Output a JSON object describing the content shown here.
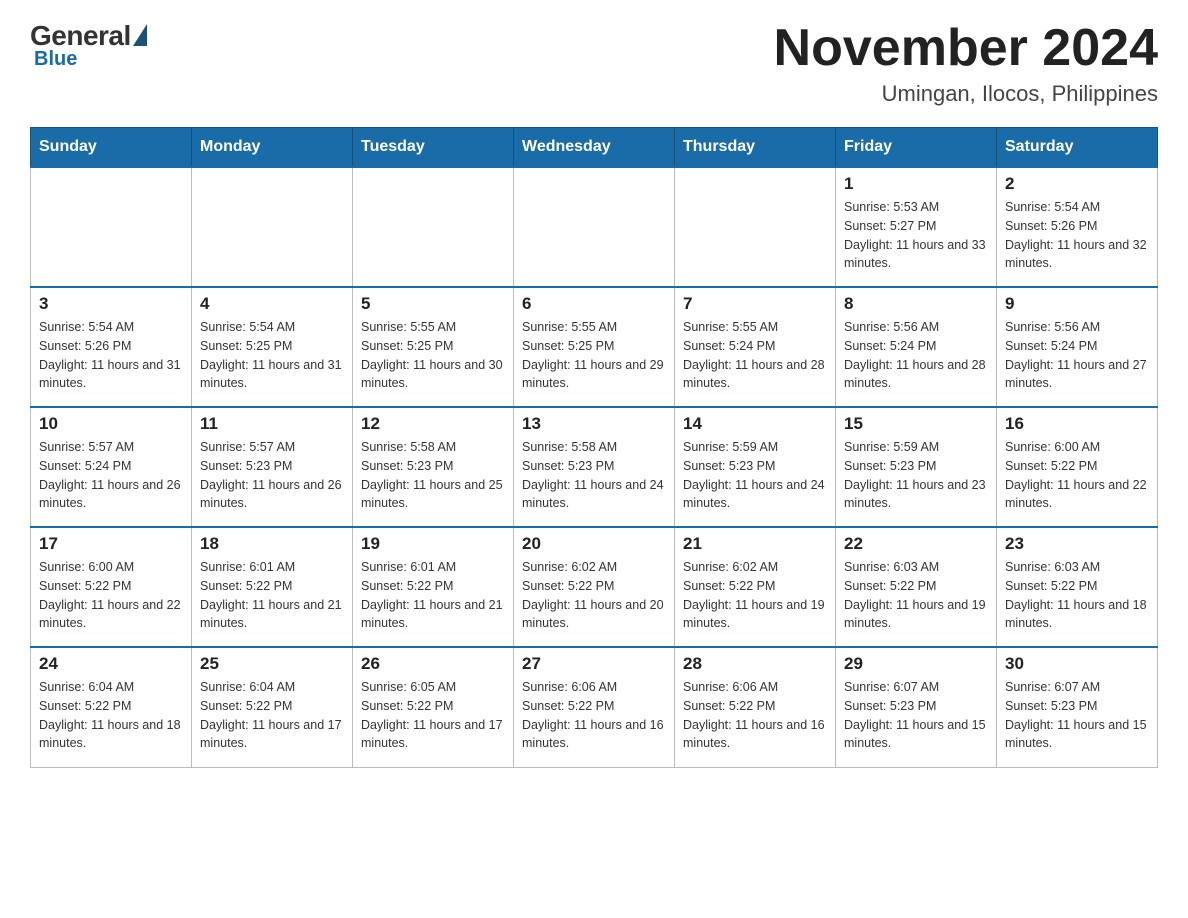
{
  "header": {
    "logo_general": "General",
    "logo_blue": "Blue",
    "month_title": "November 2024",
    "location": "Umingan, Ilocos, Philippines"
  },
  "weekdays": [
    "Sunday",
    "Monday",
    "Tuesday",
    "Wednesday",
    "Thursday",
    "Friday",
    "Saturday"
  ],
  "weeks": [
    [
      {
        "day": "",
        "sunrise": "",
        "sunset": "",
        "daylight": ""
      },
      {
        "day": "",
        "sunrise": "",
        "sunset": "",
        "daylight": ""
      },
      {
        "day": "",
        "sunrise": "",
        "sunset": "",
        "daylight": ""
      },
      {
        "day": "",
        "sunrise": "",
        "sunset": "",
        "daylight": ""
      },
      {
        "day": "",
        "sunrise": "",
        "sunset": "",
        "daylight": ""
      },
      {
        "day": "1",
        "sunrise": "Sunrise: 5:53 AM",
        "sunset": "Sunset: 5:27 PM",
        "daylight": "Daylight: 11 hours and 33 minutes."
      },
      {
        "day": "2",
        "sunrise": "Sunrise: 5:54 AM",
        "sunset": "Sunset: 5:26 PM",
        "daylight": "Daylight: 11 hours and 32 minutes."
      }
    ],
    [
      {
        "day": "3",
        "sunrise": "Sunrise: 5:54 AM",
        "sunset": "Sunset: 5:26 PM",
        "daylight": "Daylight: 11 hours and 31 minutes."
      },
      {
        "day": "4",
        "sunrise": "Sunrise: 5:54 AM",
        "sunset": "Sunset: 5:25 PM",
        "daylight": "Daylight: 11 hours and 31 minutes."
      },
      {
        "day": "5",
        "sunrise": "Sunrise: 5:55 AM",
        "sunset": "Sunset: 5:25 PM",
        "daylight": "Daylight: 11 hours and 30 minutes."
      },
      {
        "day": "6",
        "sunrise": "Sunrise: 5:55 AM",
        "sunset": "Sunset: 5:25 PM",
        "daylight": "Daylight: 11 hours and 29 minutes."
      },
      {
        "day": "7",
        "sunrise": "Sunrise: 5:55 AM",
        "sunset": "Sunset: 5:24 PM",
        "daylight": "Daylight: 11 hours and 28 minutes."
      },
      {
        "day": "8",
        "sunrise": "Sunrise: 5:56 AM",
        "sunset": "Sunset: 5:24 PM",
        "daylight": "Daylight: 11 hours and 28 minutes."
      },
      {
        "day": "9",
        "sunrise": "Sunrise: 5:56 AM",
        "sunset": "Sunset: 5:24 PM",
        "daylight": "Daylight: 11 hours and 27 minutes."
      }
    ],
    [
      {
        "day": "10",
        "sunrise": "Sunrise: 5:57 AM",
        "sunset": "Sunset: 5:24 PM",
        "daylight": "Daylight: 11 hours and 26 minutes."
      },
      {
        "day": "11",
        "sunrise": "Sunrise: 5:57 AM",
        "sunset": "Sunset: 5:23 PM",
        "daylight": "Daylight: 11 hours and 26 minutes."
      },
      {
        "day": "12",
        "sunrise": "Sunrise: 5:58 AM",
        "sunset": "Sunset: 5:23 PM",
        "daylight": "Daylight: 11 hours and 25 minutes."
      },
      {
        "day": "13",
        "sunrise": "Sunrise: 5:58 AM",
        "sunset": "Sunset: 5:23 PM",
        "daylight": "Daylight: 11 hours and 24 minutes."
      },
      {
        "day": "14",
        "sunrise": "Sunrise: 5:59 AM",
        "sunset": "Sunset: 5:23 PM",
        "daylight": "Daylight: 11 hours and 24 minutes."
      },
      {
        "day": "15",
        "sunrise": "Sunrise: 5:59 AM",
        "sunset": "Sunset: 5:23 PM",
        "daylight": "Daylight: 11 hours and 23 minutes."
      },
      {
        "day": "16",
        "sunrise": "Sunrise: 6:00 AM",
        "sunset": "Sunset: 5:22 PM",
        "daylight": "Daylight: 11 hours and 22 minutes."
      }
    ],
    [
      {
        "day": "17",
        "sunrise": "Sunrise: 6:00 AM",
        "sunset": "Sunset: 5:22 PM",
        "daylight": "Daylight: 11 hours and 22 minutes."
      },
      {
        "day": "18",
        "sunrise": "Sunrise: 6:01 AM",
        "sunset": "Sunset: 5:22 PM",
        "daylight": "Daylight: 11 hours and 21 minutes."
      },
      {
        "day": "19",
        "sunrise": "Sunrise: 6:01 AM",
        "sunset": "Sunset: 5:22 PM",
        "daylight": "Daylight: 11 hours and 21 minutes."
      },
      {
        "day": "20",
        "sunrise": "Sunrise: 6:02 AM",
        "sunset": "Sunset: 5:22 PM",
        "daylight": "Daylight: 11 hours and 20 minutes."
      },
      {
        "day": "21",
        "sunrise": "Sunrise: 6:02 AM",
        "sunset": "Sunset: 5:22 PM",
        "daylight": "Daylight: 11 hours and 19 minutes."
      },
      {
        "day": "22",
        "sunrise": "Sunrise: 6:03 AM",
        "sunset": "Sunset: 5:22 PM",
        "daylight": "Daylight: 11 hours and 19 minutes."
      },
      {
        "day": "23",
        "sunrise": "Sunrise: 6:03 AM",
        "sunset": "Sunset: 5:22 PM",
        "daylight": "Daylight: 11 hours and 18 minutes."
      }
    ],
    [
      {
        "day": "24",
        "sunrise": "Sunrise: 6:04 AM",
        "sunset": "Sunset: 5:22 PM",
        "daylight": "Daylight: 11 hours and 18 minutes."
      },
      {
        "day": "25",
        "sunrise": "Sunrise: 6:04 AM",
        "sunset": "Sunset: 5:22 PM",
        "daylight": "Daylight: 11 hours and 17 minutes."
      },
      {
        "day": "26",
        "sunrise": "Sunrise: 6:05 AM",
        "sunset": "Sunset: 5:22 PM",
        "daylight": "Daylight: 11 hours and 17 minutes."
      },
      {
        "day": "27",
        "sunrise": "Sunrise: 6:06 AM",
        "sunset": "Sunset: 5:22 PM",
        "daylight": "Daylight: 11 hours and 16 minutes."
      },
      {
        "day": "28",
        "sunrise": "Sunrise: 6:06 AM",
        "sunset": "Sunset: 5:22 PM",
        "daylight": "Daylight: 11 hours and 16 minutes."
      },
      {
        "day": "29",
        "sunrise": "Sunrise: 6:07 AM",
        "sunset": "Sunset: 5:23 PM",
        "daylight": "Daylight: 11 hours and 15 minutes."
      },
      {
        "day": "30",
        "sunrise": "Sunrise: 6:07 AM",
        "sunset": "Sunset: 5:23 PM",
        "daylight": "Daylight: 11 hours and 15 minutes."
      }
    ]
  ]
}
